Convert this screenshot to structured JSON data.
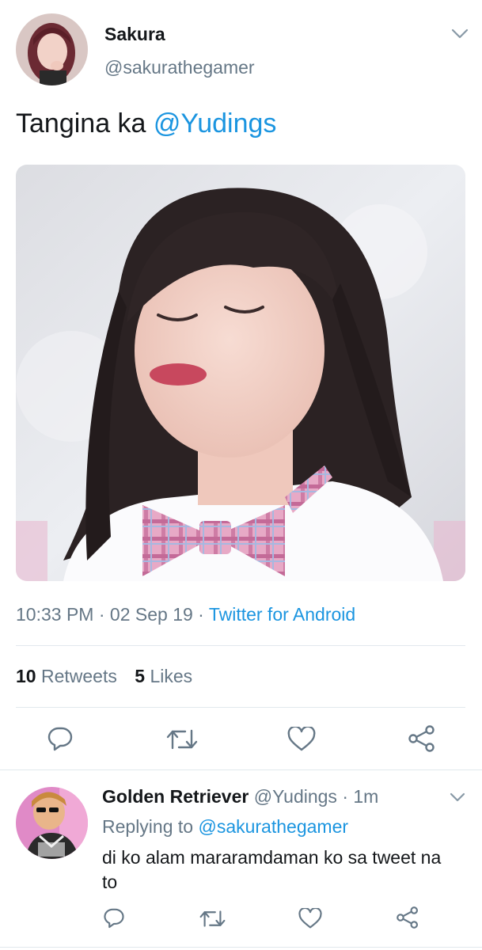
{
  "tweet": {
    "display_name": "Sakura",
    "handle": "@sakurathegamer",
    "text_prefix": "Tangina ka ",
    "mention": "@Yudings",
    "time": "10:33 PM",
    "sep1": " · ",
    "date": "02 Sep 19",
    "sep2": " · ",
    "source": "Twitter for Android",
    "retweet_count": "10",
    "retweet_label": "Retweets",
    "like_count": "5",
    "like_label": "Likes"
  },
  "reply": {
    "display_name": "Golden Retriever",
    "handle": "@Yudings",
    "dot": " · ",
    "age": "1m",
    "replying_prefix": "Replying to ",
    "replying_to": "@sakurathegamer",
    "text": "di ko alam mararamdaman ko sa tweet na to"
  },
  "colors": {
    "link": "#1b95e0",
    "muted": "#657786",
    "divider": "#e1e8ed"
  },
  "icons": [
    "chevron-down-icon",
    "reply-icon",
    "retweet-icon",
    "like-icon",
    "share-icon"
  ]
}
